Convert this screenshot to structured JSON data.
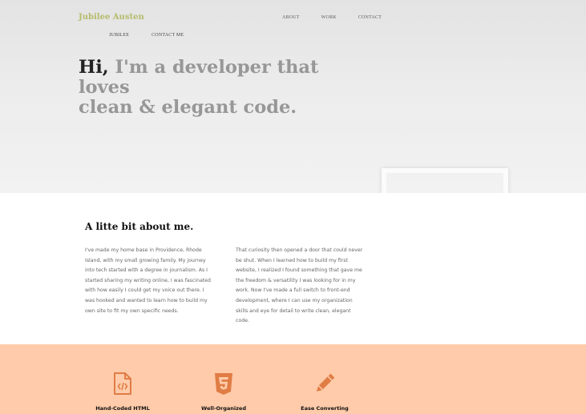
{
  "brand": "Jubilee Austen",
  "top_nav": [
    "ABOUT",
    "WORK",
    "CONTACT"
  ],
  "sub_nav": [
    "JUBILEE",
    "CONTACT ME"
  ],
  "hero": {
    "greeting": "Hi,",
    "line1_rest": " I'm a developer that loves",
    "line2": "clean & elegant code."
  },
  "about": {
    "title": "A litte bit about me.",
    "col1": "I've made my home base in Providence, Rhode Island, with my small growing family. My journey into tech started with a degree in journalism. As I started sharing my writing online, I was fascinated with how easily I could get my voice out there. I was hooked and wanted to learn how to build my own site to fit my own specific needs.",
    "col2": "That curiosity then opened a door that could never be shut. When I learned how to build my first website, I realized I found something that gave me the freedom & versatility I was looking for in my work. Now I've made a full switch to front-end development, where I can use my organization skills and eye for detail to write clean, elegant code."
  },
  "features": [
    {
      "label": "Hand-Coded HTML",
      "icon": "code-file-icon"
    },
    {
      "label": "Well-Organized",
      "icon": "css3-icon"
    },
    {
      "label": "Ease Converting",
      "icon": "pencil-icon"
    }
  ],
  "colors": {
    "brand": "#b4bb6a",
    "icon_accent": "#e07d45",
    "features_bg": "#ffcbaa"
  }
}
